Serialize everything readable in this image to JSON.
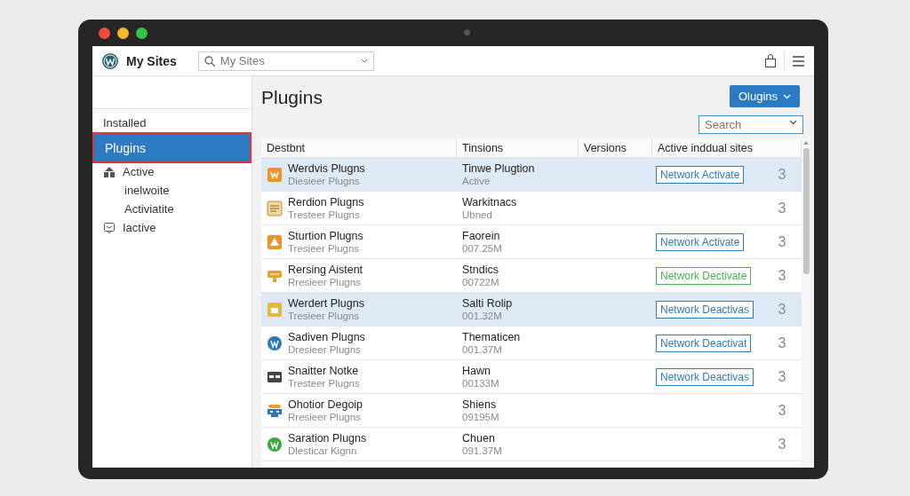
{
  "topbar": {
    "title": "My Sites",
    "site_picker": {
      "value": "My Sites"
    }
  },
  "sidebar": {
    "heading": "Installed",
    "items": [
      {
        "label": "Plugins",
        "selected": true,
        "kind": "plain"
      },
      {
        "label": "Active",
        "selected": false,
        "kind": "people",
        "children": [
          {
            "label": "inelwoite",
            "selected": false
          },
          {
            "label": "Activiatite",
            "selected": false
          }
        ]
      },
      {
        "label": "Iactive",
        "selected": false,
        "kind": "chat"
      }
    ]
  },
  "main": {
    "title": "Plugins",
    "action_button": "Olugins",
    "search": {
      "placeholder": "Search"
    },
    "table": {
      "columns": [
        "Destbnt",
        "Tinsions",
        "Versions",
        "Active inddual sites"
      ],
      "rows": [
        {
          "name": "Werdvis Plugns",
          "subtitle": "Diesieer Plugns",
          "detail": "Tinwe Plugtion",
          "detail_sub": "Active",
          "kind": "badge",
          "selected": true,
          "action": "Network Activate",
          "color": "#2f7ab8",
          "count": "3"
        },
        {
          "name": "Rerdion Plugns",
          "subtitle": "Tresteer Plugns",
          "detail": "Warkitnacs",
          "detail_sub": "Ubned",
          "kind": "note",
          "selected": false,
          "action": null,
          "count": "3"
        },
        {
          "name": "Sturtion Plugns",
          "subtitle": "Tresieer Plugns",
          "detail": "Faorein",
          "detail_sub": "007.25M",
          "kind": "warning",
          "selected": false,
          "action": "Network Activate",
          "color": "#2f7ab8",
          "count": "3"
        },
        {
          "name": "Rersing Aistent",
          "subtitle": "Rresieer Plugns",
          "detail": "Stndics",
          "detail_sub": "00722M",
          "kind": "sign",
          "selected": false,
          "action": "Network Dectivate",
          "color": "#4caf50",
          "count": "3"
        },
        {
          "name": "Werdert Plugns",
          "subtitle": "Tresieer Plugns",
          "detail": "Salti Rolip",
          "detail_sub": "001.32M",
          "kind": "box",
          "selected": true,
          "action": "Network Deactivas",
          "color": "#2f7ab8",
          "count": "3"
        },
        {
          "name": "Sadiven Plugns",
          "subtitle": "Dresieer Plugns",
          "detail": "Thematicen",
          "detail_sub": "001.37M",
          "kind": "wp-blue",
          "selected": false,
          "action": "Network Deactivat",
          "color": "#2f7ab8",
          "count": "3"
        },
        {
          "name": "Snaitter Notke",
          "subtitle": "Tresteer Plugns",
          "detail": "Hawn",
          "detail_sub": "00133M",
          "kind": "window",
          "selected": false,
          "action": "Network Deactivas",
          "color": "#2f7ab8",
          "count": "3"
        },
        {
          "name": "Ohotior Degoip",
          "subtitle": "Rresieer Plugns",
          "detail": "Shiens",
          "detail_sub": "09195M",
          "kind": "network",
          "selected": false,
          "action": null,
          "count": "3"
        },
        {
          "name": "Saration Plugns",
          "subtitle": "Dlesticar Kignn",
          "detail": "Chuen",
          "detail_sub": "091.37M",
          "kind": "wp-green",
          "selected": false,
          "action": null,
          "count": "3"
        }
      ]
    }
  }
}
